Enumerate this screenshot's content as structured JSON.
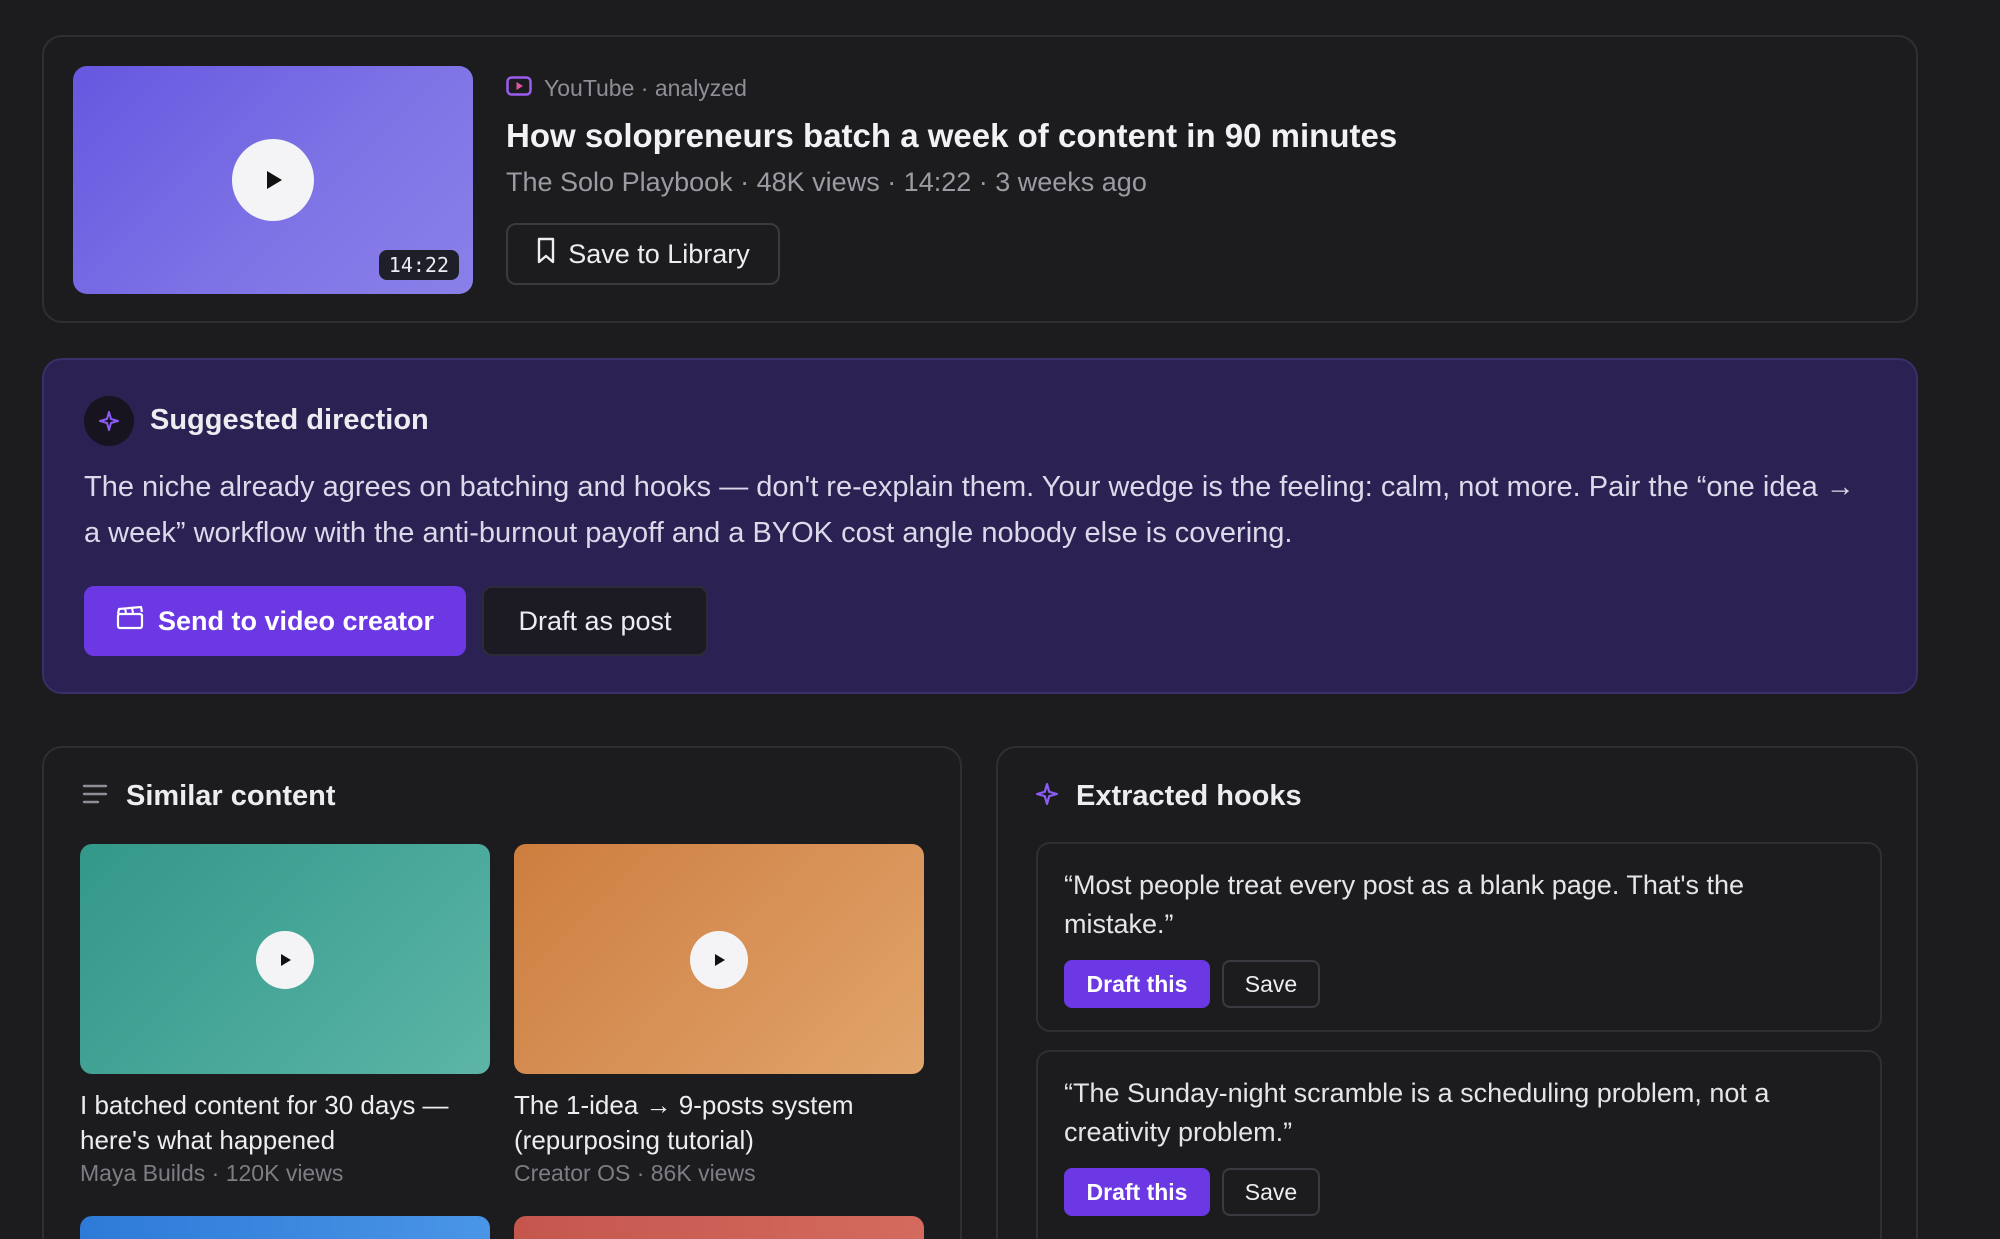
{
  "colors": {
    "background": "#1c1c1e",
    "accent": "#6b38e3",
    "direction_panel": "#2b2152"
  },
  "video": {
    "source_icon": "youtube-icon",
    "source_label": "YouTube · analyzed",
    "title": "How solopreneurs batch a week of content in 90 minutes",
    "meta": "The Solo Playbook · 48K views · 14:22 · 3 weeks ago",
    "duration": "14:22",
    "save_button": {
      "icon": "bookmark-icon",
      "label": "Save to Library"
    }
  },
  "direction": {
    "icon": "sparkle-icon",
    "title": "Suggested direction",
    "text": "The niche already agrees on batching and hooks — don't re-explain them. Your wedge is the feeling: calm, not more. Pair the “one idea → a week” workflow with the anti-burnout payoff and a BYOK cost angle nobody else is covering.",
    "primary_button": {
      "icon": "clapperboard-icon",
      "label": "Send to video creator"
    },
    "secondary_button": {
      "label": "Draft as post"
    }
  },
  "similar": {
    "icon": "list-icon",
    "title": "Similar content",
    "items": [
      {
        "title": "I batched content for 30 days — here's what happened",
        "meta": "Maya Builds · 120K views"
      },
      {
        "title": "The 1-idea → 9-posts system (repurposing tutorial)",
        "meta": "Creator OS · 86K views"
      }
    ]
  },
  "hooks": {
    "icon": "sparkle-icon",
    "title": "Extracted hooks",
    "items": [
      {
        "text": "“Most people treat every post as a blank page. That's the mistake.”",
        "draft_label": "Draft this",
        "save_label": "Save"
      },
      {
        "text": "“The Sunday-night scramble is a scheduling problem, not a creativity problem.”",
        "draft_label": "Draft this",
        "save_label": "Save"
      }
    ]
  }
}
